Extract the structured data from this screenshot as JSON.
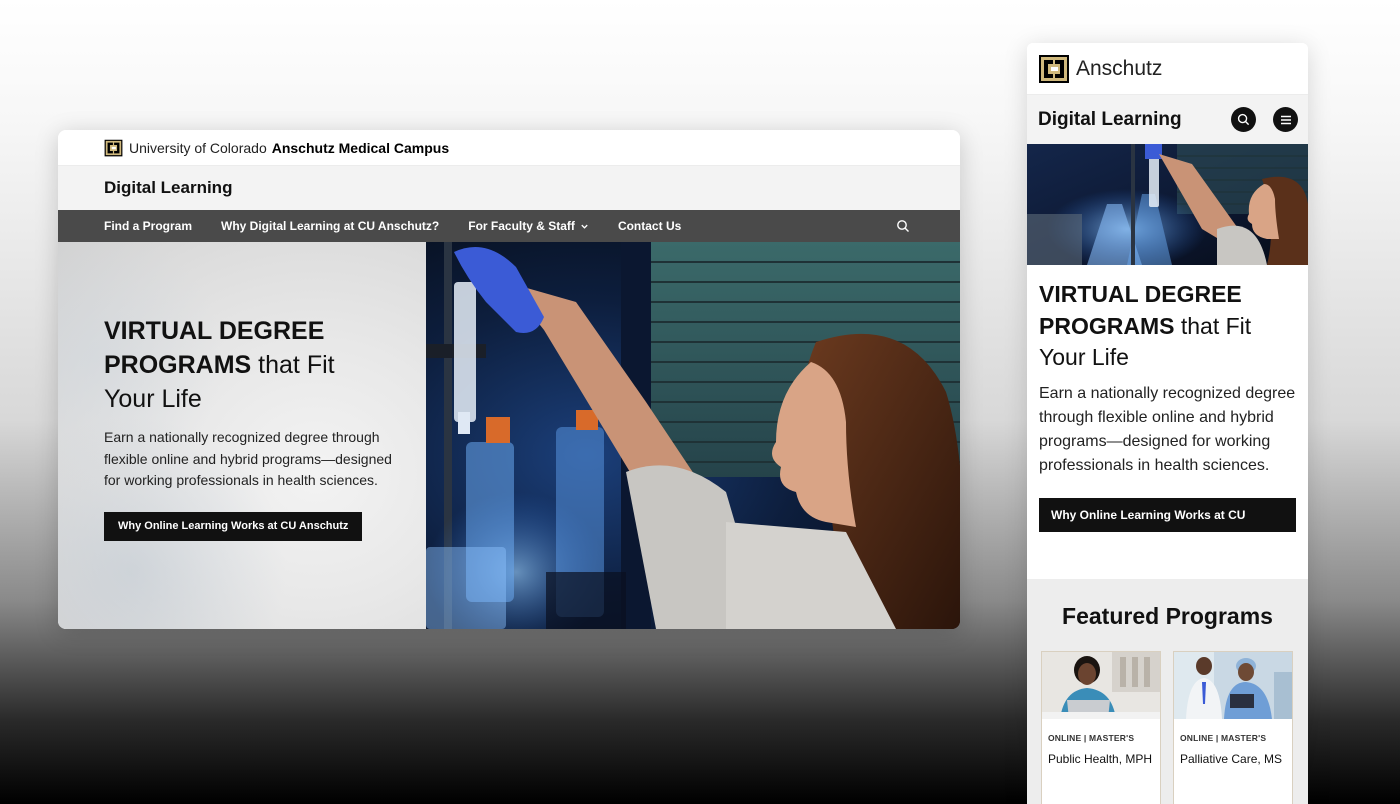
{
  "desktop": {
    "topbar": {
      "university": "University of Colorado",
      "campus": "Anschutz Medical Campus"
    },
    "site_title": "Digital Learning",
    "nav": [
      {
        "label": "Find a Program"
      },
      {
        "label": "Why Digital Learning at CU Anschutz?"
      },
      {
        "label": "For Faculty & Staff",
        "has_dropdown": true
      },
      {
        "label": "Contact Us"
      }
    ],
    "hero": {
      "headline_bold_1": "VIRTUAL DEGREE",
      "headline_bold_2": "PROGRAMS",
      "headline_light_1": " that Fit",
      "headline_light_2": "Your Life",
      "description": "Earn a nationally recognized degree through flexible online and hybrid programs—designed for working professionals in health sciences.",
      "cta_label": "Why Online Learning Works at CU Anschutz"
    }
  },
  "mobile": {
    "brand": "Anschutz",
    "site_title": "Digital Learning",
    "hero": {
      "headline_bold_1": "VIRTUAL DEGREE",
      "headline_bold_2": "PROGRAMS",
      "headline_light_1": " that Fit",
      "headline_light_2": "Your Life",
      "description": "Earn a nationally recognized degree through flexible online and hybrid programs—designed for working professionals in health sciences.",
      "cta_label": "Why Online Learning Works at CU Anschutz"
    },
    "featured": {
      "title": "Featured Programs",
      "cards": [
        {
          "tag": "ONLINE | MASTER'S",
          "name": "Public Health, MPH"
        },
        {
          "tag": "ONLINE | MASTER'S",
          "name": "Palliative Care, MS"
        }
      ]
    }
  },
  "colors": {
    "nav_bg": "#4a4a4a",
    "cta_bg": "#111111",
    "logo_gold": "#cfb87c",
    "title_bar_bg": "#f3f3f3"
  },
  "icons": [
    "cu-logo-icon",
    "search-icon",
    "chevron-down-icon",
    "menu-icon"
  ]
}
